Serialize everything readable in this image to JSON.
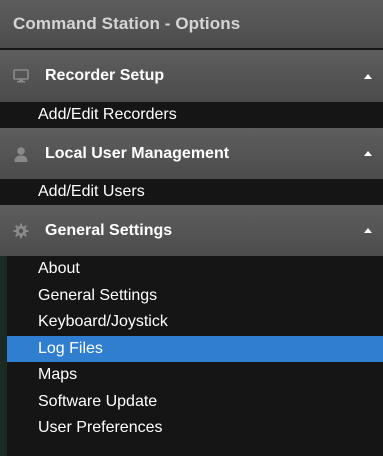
{
  "window": {
    "title": "Command Station - Options"
  },
  "sections": [
    {
      "label": "Recorder Setup",
      "icon": "monitor-icon",
      "expanded": true,
      "items": [
        "Add/Edit Recorders"
      ]
    },
    {
      "label": "Local User Management",
      "icon": "user-icon",
      "expanded": true,
      "items": [
        "Add/Edit Users"
      ]
    },
    {
      "label": "General Settings",
      "icon": "gear-icon",
      "expanded": true,
      "items": [
        "About",
        "General Settings",
        "Keyboard/Joystick",
        "Log Files",
        "Maps",
        "Software Update",
        "User Preferences"
      ]
    }
  ],
  "selected_item": "Log Files",
  "colors": {
    "selection": "#2f7ed0",
    "header": "#555555",
    "background": "#151515"
  }
}
